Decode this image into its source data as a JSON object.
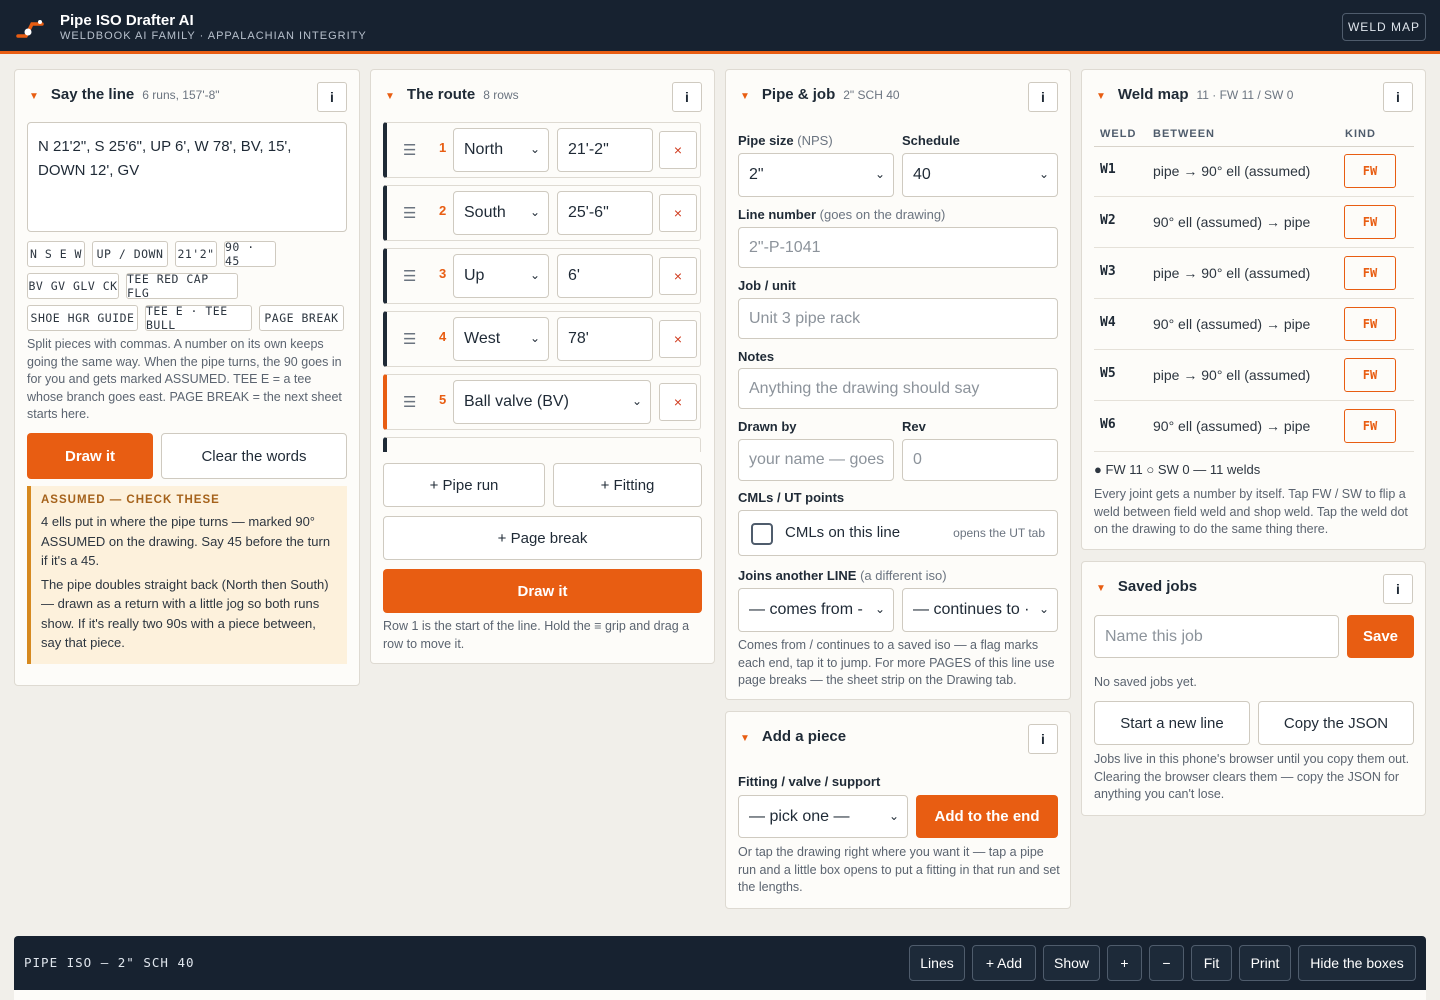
{
  "header": {
    "title": "Pipe ISO Drafter AI",
    "subtitle": "WELDBOOK AI FAMILY · APPALACHIAN INTEGRITY",
    "weld_map_button": "WELD MAP"
  },
  "say_line": {
    "title": "Say the line",
    "meta": "6 runs, 157'-8\"",
    "info": "i",
    "text": "N 21'2\", S 25'6\", UP 6', W 78', BV, 15', DOWN 12', GV",
    "chips": [
      "N S E W",
      "UP / DOWN",
      "21'2\"",
      "90 · 45",
      "BV GV GLV CK",
      "TEE RED CAP FLG",
      "SHOE HGR GUIDE",
      "TEE E · TEE BULL",
      "PAGE BREAK"
    ],
    "help": "Split pieces with commas. A number on its own keeps going the same way. When the pipe turns, the 90 goes in for you and gets marked ASSUMED. TEE E = a tee whose branch goes east. PAGE BREAK = the next sheet starts here.",
    "draw_button": "Draw it",
    "clear_button": "Clear the words",
    "assumed_title": "ASSUMED — CHECK THESE",
    "assumed_1": "4 ells put in where the pipe turns — marked 90° ASSUMED on the drawing. Say 45 before the turn if it's a 45.",
    "assumed_2": "The pipe doubles straight back (North then South) — drawn as a return with a little jog so both runs show. If it's really two 90s with a piece between, say that piece."
  },
  "route": {
    "title": "The route",
    "meta": "8 rows",
    "info": "i",
    "rows": [
      {
        "num": "1",
        "kind": "North",
        "length": "21'-2\"",
        "remove": "×"
      },
      {
        "num": "2",
        "kind": "South",
        "length": "25'-6\"",
        "remove": "×"
      },
      {
        "num": "3",
        "kind": "Up",
        "length": "6'",
        "remove": "×"
      },
      {
        "num": "4",
        "kind": "West",
        "length": "78'",
        "remove": "×"
      },
      {
        "num": "5",
        "kind": "Ball valve (BV)",
        "remove": "×"
      }
    ],
    "grip": "☰",
    "pipe_run_button": "+ Pipe run",
    "fitting_button": "+ Fitting",
    "page_break_button": "+ Page break",
    "draw_button": "Draw it",
    "help": "Row 1 is the start of the line. Hold the ≡ grip and drag a row to move it."
  },
  "pipe_job": {
    "title": "Pipe & job",
    "meta": "2\" SCH 40",
    "info": "i",
    "pipe_size_label": "Pipe size",
    "pipe_size_hint": "(NPS)",
    "pipe_size_value": "2\"",
    "schedule_label": "Schedule",
    "schedule_value": "40",
    "line_number_label": "Line number",
    "line_number_hint": "(goes on the drawing)",
    "line_number_placeholder": "2\"-P-1041",
    "job_label": "Job / unit",
    "job_placeholder": "Unit 3 pipe rack",
    "notes_label": "Notes",
    "notes_placeholder": "Anything the drawing should say",
    "drawn_by_label": "Drawn by",
    "drawn_by_placeholder": "your name — goes",
    "rev_label": "Rev",
    "rev_placeholder": "0",
    "cml_label": "CMLs / UT points",
    "cml_checkbox": "CMLs on this line",
    "cml_hint": "opens the UT tab",
    "joins_label": "Joins another LINE",
    "joins_hint": "(a different iso)",
    "comes_from": "— comes from -",
    "continues_to": "— continues to ·",
    "help": "Comes from / continues to a saved iso — a flag marks each end, tap it to jump. For more PAGES of this line use page breaks — the sheet strip on the Drawing tab."
  },
  "add_piece": {
    "title": "Add a piece",
    "info": "i",
    "label": "Fitting / valve / support",
    "select": "— pick one —",
    "add_button": "Add to the end",
    "help": "Or tap the drawing right where you want it — tap a pipe run and a little box opens to put a fitting in that run and set the lengths."
  },
  "weld_map": {
    "title": "Weld map",
    "meta": "11 · FW 11 / SW 0",
    "info": "i",
    "col_weld": "WELD",
    "col_between": "BETWEEN",
    "col_kind": "KIND",
    "rows": [
      {
        "id": "W1",
        "between": "pipe → 90° ell (assumed)",
        "kind": "FW"
      },
      {
        "id": "W2",
        "between": "90° ell (assumed) → pipe",
        "kind": "FW"
      },
      {
        "id": "W3",
        "between": "pipe → 90° ell (assumed)",
        "kind": "FW"
      },
      {
        "id": "W4",
        "between": "90° ell (assumed) → pipe",
        "kind": "FW"
      },
      {
        "id": "W5",
        "between": "pipe → 90° ell (assumed)",
        "kind": "FW"
      },
      {
        "id": "W6",
        "between": "90° ell (assumed) → pipe",
        "kind": "FW"
      }
    ],
    "summary": "● FW 11 ○ SW 0 — 11 welds",
    "help": "Every joint gets a number by itself. Tap FW / SW to flip a weld between field weld and shop weld. Tap the weld dot on the drawing to do the same thing there."
  },
  "saved_jobs": {
    "title": "Saved jobs",
    "info": "i",
    "name_placeholder": "Name this job",
    "save_button": "Save",
    "empty": "No saved jobs yet.",
    "new_line_button": "Start a new line",
    "copy_json_button": "Copy the JSON",
    "help": "Jobs live in this phone's browser until you copy them out. Clearing the browser clears them — copy the JSON for anything you can't lose."
  },
  "drawing_bar": {
    "title": "PIPE ISO — 2\" SCH 40",
    "buttons": [
      "Lines",
      "+ Add",
      "Show",
      "+",
      "−",
      "Fit",
      "Print",
      "Hide the boxes"
    ]
  },
  "colors": {
    "accent": "#e85d12",
    "navy": "#172230",
    "assumed_bg": "#fdf1dc"
  }
}
